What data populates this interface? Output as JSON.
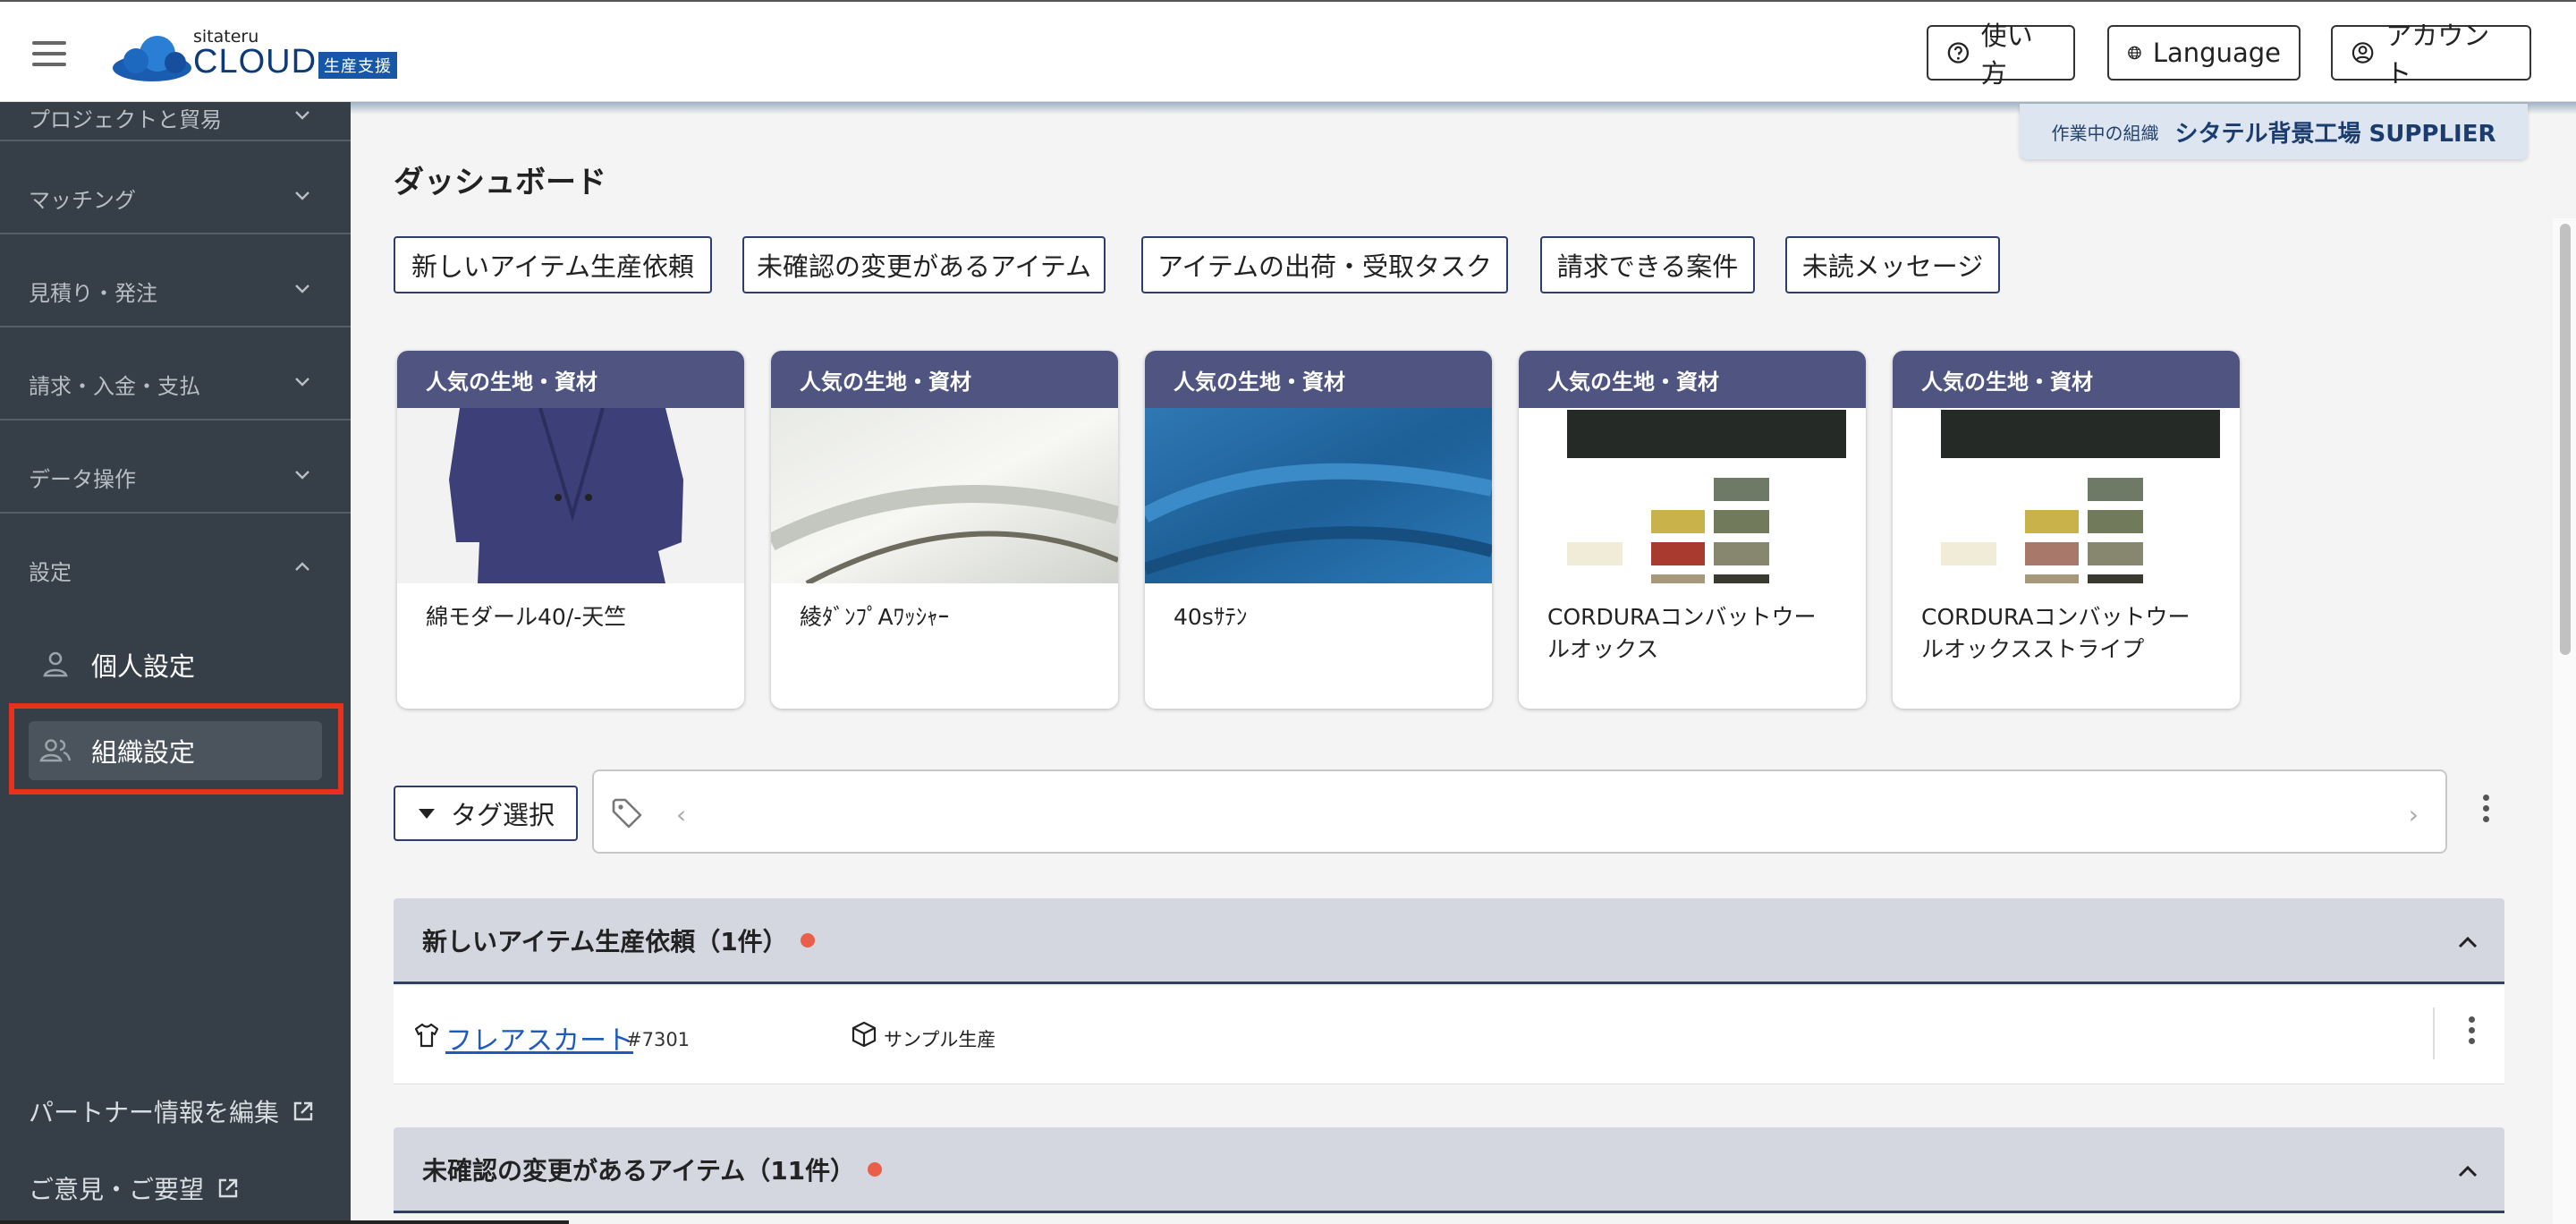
{
  "header": {
    "logo_small": "sitateru",
    "logo_big": "CLOUD",
    "logo_tag": "生産支援",
    "help_label": "使い方",
    "language_label": "Language",
    "account_label": "アカウント"
  },
  "sidebar": {
    "sections": [
      {
        "label": "プロジェクトと貿易"
      },
      {
        "label": "マッチング"
      },
      {
        "label": "見積り・発注"
      },
      {
        "label": "請求・入金・支払"
      },
      {
        "label": "データ操作"
      },
      {
        "label": "設定"
      }
    ],
    "sub_items": [
      {
        "label": "個人設定"
      },
      {
        "label": "組織設定"
      }
    ],
    "links": [
      {
        "label": "パートナー情報を編集"
      },
      {
        "label": "ご意見・ご要望"
      }
    ]
  },
  "org": {
    "caption": "作業中の組織",
    "name": "シタテル背景工場 SUPPLIER"
  },
  "main": {
    "title": "ダッシュボード",
    "quick_buttons": [
      {
        "label": "新しいアイテム生産依頼"
      },
      {
        "label": "未確認の変更があるアイテム"
      },
      {
        "label": "アイテムの出荷・受取タスク"
      },
      {
        "label": "請求できる案件"
      },
      {
        "label": "未読メッセージ"
      }
    ],
    "cards": [
      {
        "heading": "人気の生地・資材",
        "name": "綿モダール40/-天竺"
      },
      {
        "heading": "人気の生地・資材",
        "name": "綾ﾀﾞﾝﾌﾟAﾜｯｼｬｰ"
      },
      {
        "heading": "人気の生地・資材",
        "name": "40sｻﾃﾝ"
      },
      {
        "heading": "人気の生地・資材",
        "name": "CORDURAコンバットウールオックス"
      },
      {
        "heading": "人気の生地・資材",
        "name": "CORDURAコンバットウールオックスストライプ"
      }
    ],
    "tag_select_label": "タグ選択",
    "tag_prev": "‹",
    "tag_next": "›",
    "sections": [
      {
        "title": "新しいアイテム生産依頼（1件）"
      },
      {
        "title": "未確認の変更があるアイテム（11件）"
      }
    ],
    "rows": [
      {
        "item_name": "フレアスカート",
        "item_number": "#7301",
        "item_type": "サンプル生産"
      }
    ]
  },
  "colors": {
    "sidebar_bg": "#363f47",
    "card_header": "#4f5580",
    "accent_navy": "#2e3d6b",
    "highlight_red": "#e8311c",
    "notification_dot": "#e8604a",
    "link_blue": "#1e5bbd"
  },
  "icons": [
    "hamburger-icon",
    "help-icon",
    "globe-icon",
    "account-icon",
    "chevron-down-icon",
    "chevron-up-icon",
    "person-icon",
    "people-icon",
    "external-link-icon",
    "tag-icon",
    "shirt-icon",
    "box-icon",
    "more-vert-icon"
  ]
}
